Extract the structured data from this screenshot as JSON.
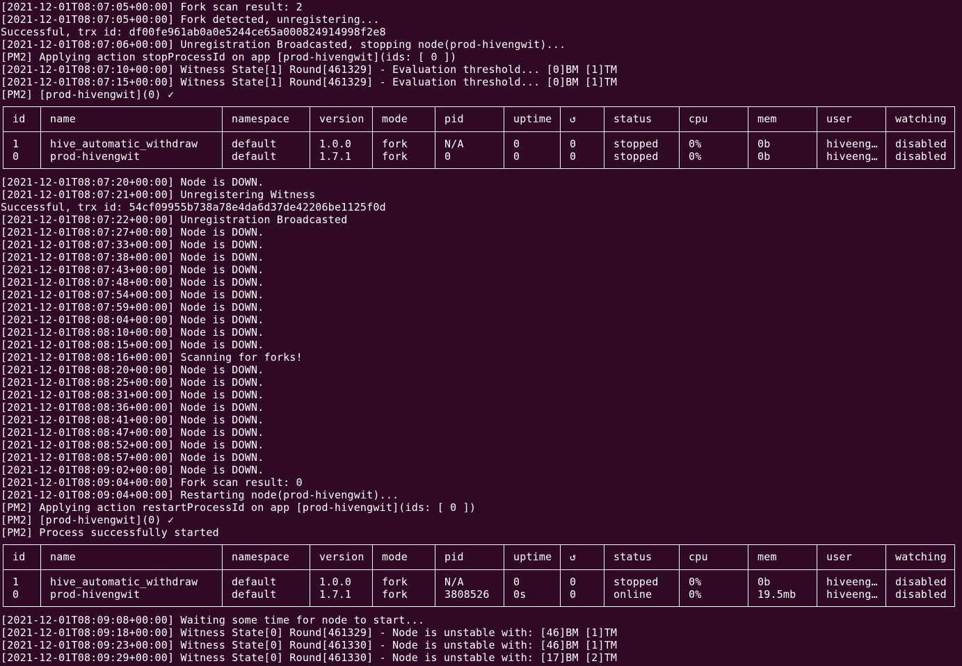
{
  "colors": {
    "background": "#300a24",
    "text": "#ffffff"
  },
  "log_before_table1": [
    "[2021-12-01T08:07:05+00:00] Fork scan result: 2",
    "[2021-12-01T08:07:05+00:00] Fork detected, unregistering...",
    "Successful, trx id: df00fe961ab0a0e5244ce65a000824914998f2e8",
    "[2021-12-01T08:07:06+00:00] Unregistration Broadcasted, stopping node(prod-hivengwit)...",
    "[PM2] Applying action stopProcessId on app [prod-hivengwit](ids: [ 0 ])",
    "[2021-12-01T08:07:10+00:00] Witness State[1] Round[461329] - Evaluation threshold... [0]BM [1]TM",
    "[2021-12-01T08:07:15+00:00] Witness State[1] Round[461329] - Evaluation threshold... [0]BM [1]TM",
    "[PM2] [prod-hivengwit](0) ✓"
  ],
  "table_headers": [
    "id",
    "name",
    "namespace",
    "version",
    "mode",
    "pid",
    "uptime",
    "↺",
    "status",
    "cpu",
    "mem",
    "user",
    "watching"
  ],
  "table1_rows": [
    [
      "1",
      "hive_automatic_withdraw",
      "default",
      "1.0.0",
      "fork",
      "N/A",
      "0",
      "0",
      "stopped",
      "0%",
      "0b",
      "hiveeng…",
      "disabled"
    ],
    [
      "0",
      "prod-hivengwit",
      "default",
      "1.7.1",
      "fork",
      "0",
      "0",
      "0",
      "stopped",
      "0%",
      "0b",
      "hiveeng…",
      "disabled"
    ]
  ],
  "log_between_tables": [
    "[2021-12-01T08:07:20+00:00] Node is DOWN.",
    "[2021-12-01T08:07:21+00:00] Unregistering Witness",
    "Successful, trx id: 54cf09955b738a78e4da6d37de42206be1125f0d",
    "[2021-12-01T08:07:22+00:00] Unregistration Broadcasted",
    "[2021-12-01T08:07:27+00:00] Node is DOWN.",
    "[2021-12-01T08:07:33+00:00] Node is DOWN.",
    "[2021-12-01T08:07:38+00:00] Node is DOWN.",
    "[2021-12-01T08:07:43+00:00] Node is DOWN.",
    "[2021-12-01T08:07:48+00:00] Node is DOWN.",
    "[2021-12-01T08:07:54+00:00] Node is DOWN.",
    "[2021-12-01T08:07:59+00:00] Node is DOWN.",
    "[2021-12-01T08:08:04+00:00] Node is DOWN.",
    "[2021-12-01T08:08:10+00:00] Node is DOWN.",
    "[2021-12-01T08:08:15+00:00] Node is DOWN.",
    "[2021-12-01T08:08:16+00:00] Scanning for forks!",
    "[2021-12-01T08:08:20+00:00] Node is DOWN.",
    "[2021-12-01T08:08:25+00:00] Node is DOWN.",
    "[2021-12-01T08:08:31+00:00] Node is DOWN.",
    "[2021-12-01T08:08:36+00:00] Node is DOWN.",
    "[2021-12-01T08:08:41+00:00] Node is DOWN.",
    "[2021-12-01T08:08:47+00:00] Node is DOWN.",
    "[2021-12-01T08:08:52+00:00] Node is DOWN.",
    "[2021-12-01T08:08:57+00:00] Node is DOWN.",
    "[2021-12-01T08:09:02+00:00] Node is DOWN.",
    "[2021-12-01T08:09:04+00:00] Fork scan result: 0",
    "[2021-12-01T08:09:04+00:00] Restarting node(prod-hivengwit)...",
    "[PM2] Applying action restartProcessId on app [prod-hivengwit](ids: [ 0 ])",
    "[PM2] [prod-hivengwit](0) ✓",
    "[PM2] Process successfully started"
  ],
  "table2_rows": [
    [
      "1",
      "hive_automatic_withdraw",
      "default",
      "1.0.0",
      "fork",
      "N/A",
      "0",
      "0",
      "stopped",
      "0%",
      "0b",
      "hiveeng…",
      "disabled"
    ],
    [
      "0",
      "prod-hivengwit",
      "default",
      "1.7.1",
      "fork",
      "3808526",
      "0s",
      "0",
      "online",
      "0%",
      "19.5mb",
      "hiveeng…",
      "disabled"
    ]
  ],
  "log_after_table2": [
    "[2021-12-01T08:09:08+00:00] Waiting some time for node to start...",
    "[2021-12-01T08:09:18+00:00] Witness State[0] Round[461329] - Node is unstable with: [46]BM [1]TM",
    "[2021-12-01T08:09:23+00:00] Witness State[0] Round[461330] - Node is unstable with: [46]BM [1]TM",
    "[2021-12-01T08:09:29+00:00] Witness State[0] Round[461330] - Node is unstable with: [17]BM [2]TM"
  ]
}
